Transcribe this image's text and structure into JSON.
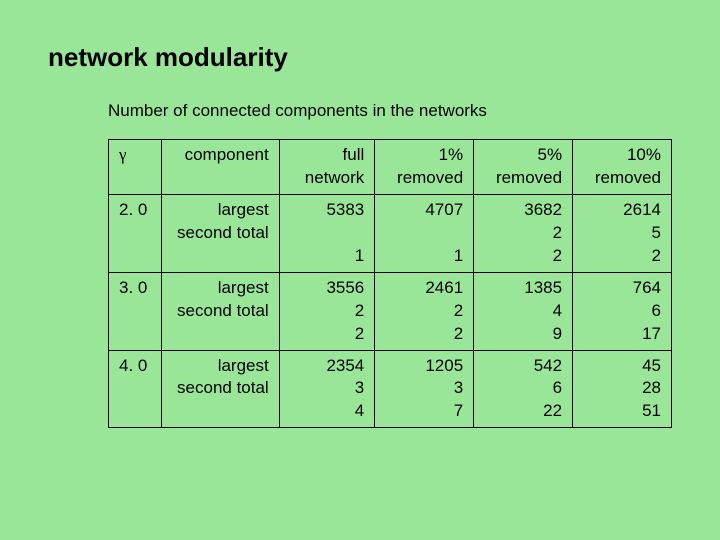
{
  "title": "network modularity",
  "subtitle": "Number of connected components in the networks",
  "headers": {
    "gamma": "γ",
    "component": "component",
    "full": "full network",
    "p1": "1% removed",
    "p5": "5% removed",
    "p10": "10% removed"
  },
  "component_labels": "largest\nsecond\ntotal",
  "rows": [
    {
      "gamma": "2. 0",
      "full": "5383\n\n1",
      "p1": "4707\n\n1",
      "p5": "3682\n2\n2",
      "p10": "2614\n5\n2"
    },
    {
      "gamma": "3. 0",
      "full": "3556\n2\n2",
      "p1": "2461\n2\n2",
      "p5": "1385\n4\n9",
      "p10": "764\n6\n17"
    },
    {
      "gamma": "4. 0",
      "full": "2354\n3\n4",
      "p1": "1205\n3\n7",
      "p5": "542\n6\n22",
      "p10": "45\n28\n51"
    }
  ],
  "chart_data": {
    "type": "table",
    "title": "Number of connected components in the networks",
    "columns": [
      "γ",
      "component",
      "full network",
      "1% removed",
      "5% removed",
      "10% removed"
    ],
    "rows": [
      {
        "gamma": 2.0,
        "component": "largest",
        "full_network": 5383,
        "1%_removed": 4707,
        "5%_removed": 3682,
        "10%_removed": 2614
      },
      {
        "gamma": 2.0,
        "component": "second",
        "full_network": null,
        "1%_removed": null,
        "5%_removed": 2,
        "10%_removed": 5
      },
      {
        "gamma": 2.0,
        "component": "total",
        "full_network": 1,
        "1%_removed": 1,
        "5%_removed": 2,
        "10%_removed": 2
      },
      {
        "gamma": 3.0,
        "component": "largest",
        "full_network": 3556,
        "1%_removed": 2461,
        "5%_removed": 1385,
        "10%_removed": 764
      },
      {
        "gamma": 3.0,
        "component": "second",
        "full_network": 2,
        "1%_removed": 2,
        "5%_removed": 4,
        "10%_removed": 6
      },
      {
        "gamma": 3.0,
        "component": "total",
        "full_network": 2,
        "1%_removed": 2,
        "5%_removed": 9,
        "10%_removed": 17
      },
      {
        "gamma": 4.0,
        "component": "largest",
        "full_network": 2354,
        "1%_removed": 1205,
        "5%_removed": 542,
        "10%_removed": 45
      },
      {
        "gamma": 4.0,
        "component": "second",
        "full_network": 3,
        "1%_removed": 3,
        "5%_removed": 6,
        "10%_removed": 28
      },
      {
        "gamma": 4.0,
        "component": "total",
        "full_network": 4,
        "1%_removed": 7,
        "5%_removed": 22,
        "10%_removed": 51
      }
    ]
  }
}
